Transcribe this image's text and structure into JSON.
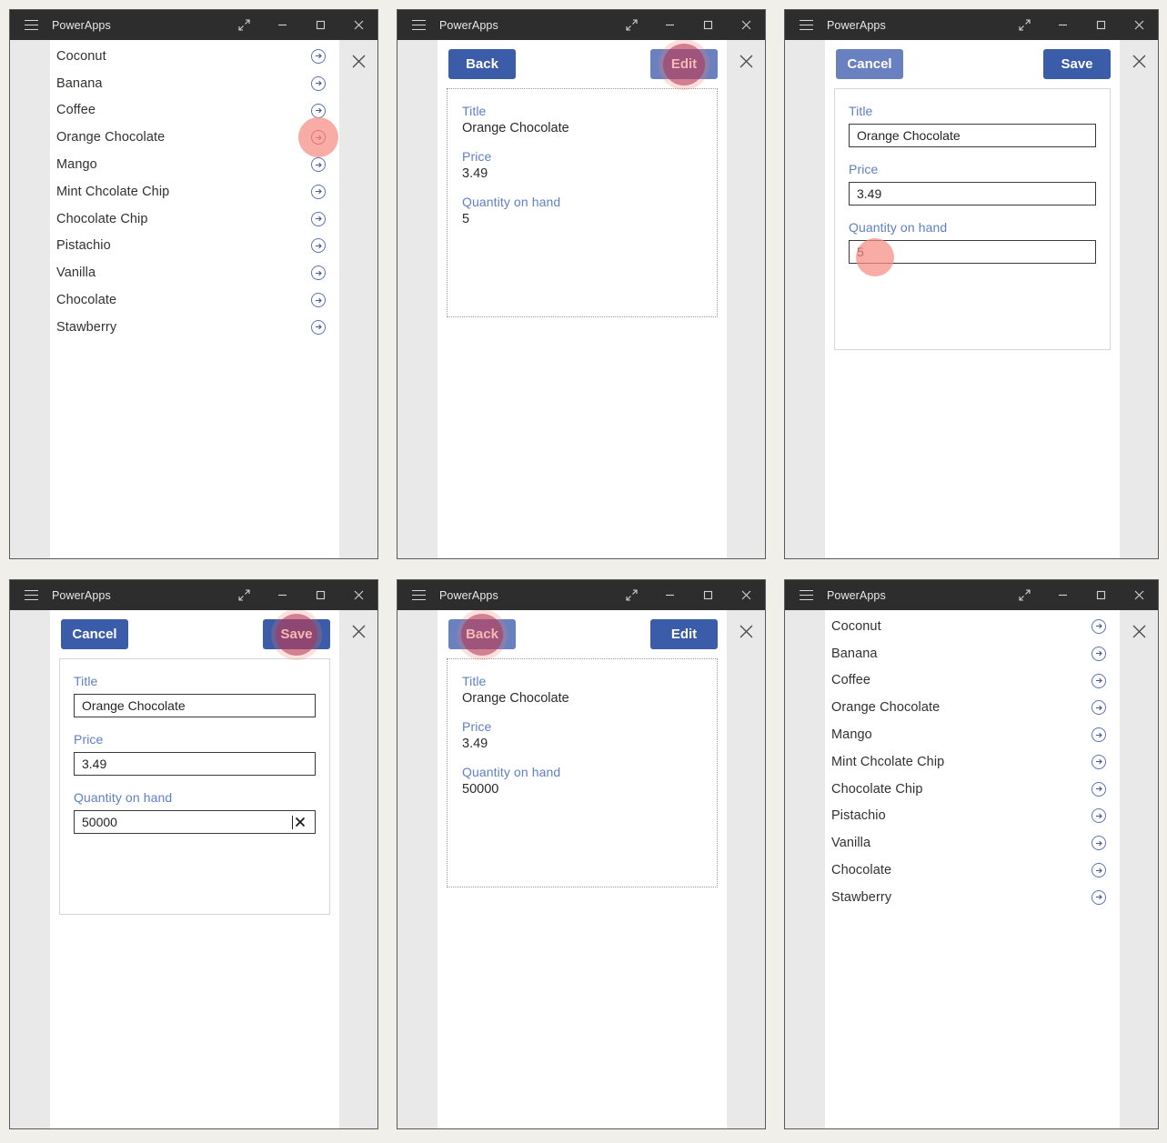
{
  "window": {
    "title": "PowerApps",
    "controls": {
      "menu": "hamburger-menu-icon",
      "restore": "expand-icon",
      "minimize": "minimize-icon",
      "maximize": "maximize-icon",
      "close": "close-icon"
    },
    "app_close": "app-close-icon"
  },
  "colors": {
    "titlebar_bg": "#2d2d2d",
    "button_primary": "#3b5ca8",
    "button_pressed": "#6981c0",
    "label_blue": "#5f7fc6",
    "arrow_blue": "#5b72b8",
    "click_halo": "#f4786e",
    "click_dot": "#b03153",
    "page_bg": "#f0efe9",
    "app_bg": "#e9e9e9"
  },
  "gallery": {
    "items": [
      {
        "label": "Coconut",
        "icon": "arrow-right-circle-icon"
      },
      {
        "label": "Banana",
        "icon": "arrow-right-circle-icon"
      },
      {
        "label": "Coffee",
        "icon": "arrow-right-circle-icon"
      },
      {
        "label": "Orange Chocolate",
        "icon": "arrow-right-circle-icon"
      },
      {
        "label": "Mango",
        "icon": "arrow-right-circle-icon"
      },
      {
        "label": "Mint Chcolate Chip",
        "icon": "arrow-right-circle-icon"
      },
      {
        "label": "Chocolate Chip",
        "icon": "arrow-right-circle-icon"
      },
      {
        "label": "Pistachio",
        "icon": "arrow-right-circle-icon"
      },
      {
        "label": "Vanilla",
        "icon": "arrow-right-circle-icon"
      },
      {
        "label": "Chocolate",
        "icon": "arrow-right-circle-icon"
      },
      {
        "label": "Stawberry",
        "icon": "arrow-right-circle-icon"
      }
    ]
  },
  "buttons": {
    "back": "Back",
    "edit": "Edit",
    "cancel": "Cancel",
    "save": "Save"
  },
  "fields": {
    "title_label": "Title",
    "price_label": "Price",
    "quantity_label": "Quantity on hand"
  },
  "record_before": {
    "title": "Orange Chocolate",
    "price": "3.49",
    "quantity": "5"
  },
  "record_after": {
    "title": "Orange Chocolate",
    "price": "3.49",
    "quantity": "50000"
  },
  "panels": {
    "p1": {
      "step": "1",
      "screen": "browse-gallery",
      "clicked": "arrow-orange-chocolate"
    },
    "p2": {
      "step": "2",
      "screen": "detail",
      "clicked": "edit-button"
    },
    "p3": {
      "step": "3",
      "screen": "edit-form",
      "clicked": "quantity-input"
    },
    "p4": {
      "step": "4",
      "screen": "edit-form",
      "clicked": "save-button"
    },
    "p5": {
      "step": "5",
      "screen": "detail",
      "clicked": "back-button"
    },
    "p6": {
      "step": "6",
      "screen": "browse-gallery",
      "clicked": "none"
    }
  },
  "clear_icon": "clear-x-icon"
}
